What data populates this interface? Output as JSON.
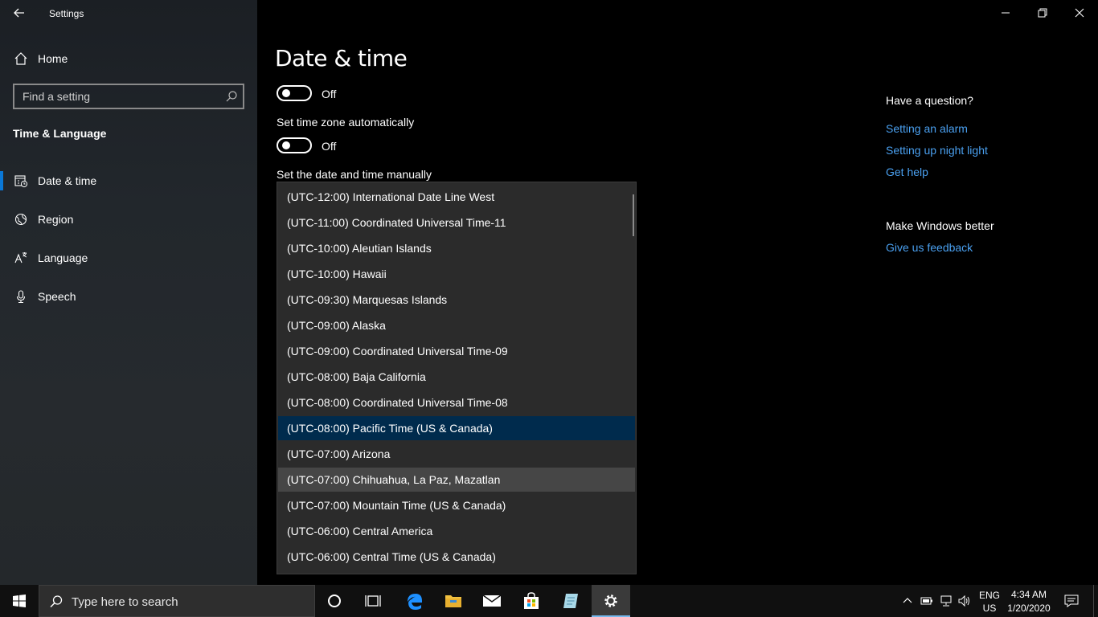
{
  "window": {
    "title": "Settings"
  },
  "sidebar": {
    "home_label": "Home",
    "search_placeholder": "Find a setting",
    "section_title": "Time & Language",
    "items": [
      {
        "label": "Date & time",
        "icon": "calendar-clock-icon",
        "selected": true
      },
      {
        "label": "Region",
        "icon": "globe-icon"
      },
      {
        "label": "Language",
        "icon": "language-icon"
      },
      {
        "label": "Speech",
        "icon": "microphone-icon"
      }
    ]
  },
  "main": {
    "title": "Date & time",
    "toggle1_state": "Off",
    "timezone_auto_label": "Set time zone automatically",
    "toggle2_state": "Off",
    "manual_label": "Set the date and time manually",
    "timezones": [
      "(UTC-12:00) International Date Line West",
      "(UTC-11:00) Coordinated Universal Time-11",
      "(UTC-10:00) Aleutian Islands",
      "(UTC-10:00) Hawaii",
      "(UTC-09:30) Marquesas Islands",
      "(UTC-09:00) Alaska",
      "(UTC-09:00) Coordinated Universal Time-09",
      "(UTC-08:00) Baja California",
      "(UTC-08:00) Coordinated Universal Time-08",
      "(UTC-08:00) Pacific Time (US & Canada)",
      "(UTC-07:00) Arizona",
      "(UTC-07:00) Chihuahua, La Paz, Mazatlan",
      "(UTC-07:00) Mountain Time (US & Canada)",
      "(UTC-06:00) Central America",
      "(UTC-06:00) Central Time (US & Canada)"
    ],
    "selected_timezone": "(UTC-08:00) Pacific Time (US & Canada)",
    "hovered_timezone": "(UTC-07:00) Chihuahua, La Paz, Mazatlan"
  },
  "right_panel": {
    "question_heading": "Have a question?",
    "links": [
      "Setting an alarm",
      "Setting up night light",
      "Get help"
    ],
    "better_heading": "Make Windows better",
    "feedback_link": "Give us feedback"
  },
  "taskbar": {
    "search_placeholder": "Type here to search",
    "lang_top": "ENG",
    "lang_bottom": "US",
    "time": "4:34 AM",
    "date": "1/20/2020"
  },
  "colors": {
    "accent": "#0a78d7",
    "link": "#4aa0f0",
    "selected_item": "#002b4d"
  }
}
